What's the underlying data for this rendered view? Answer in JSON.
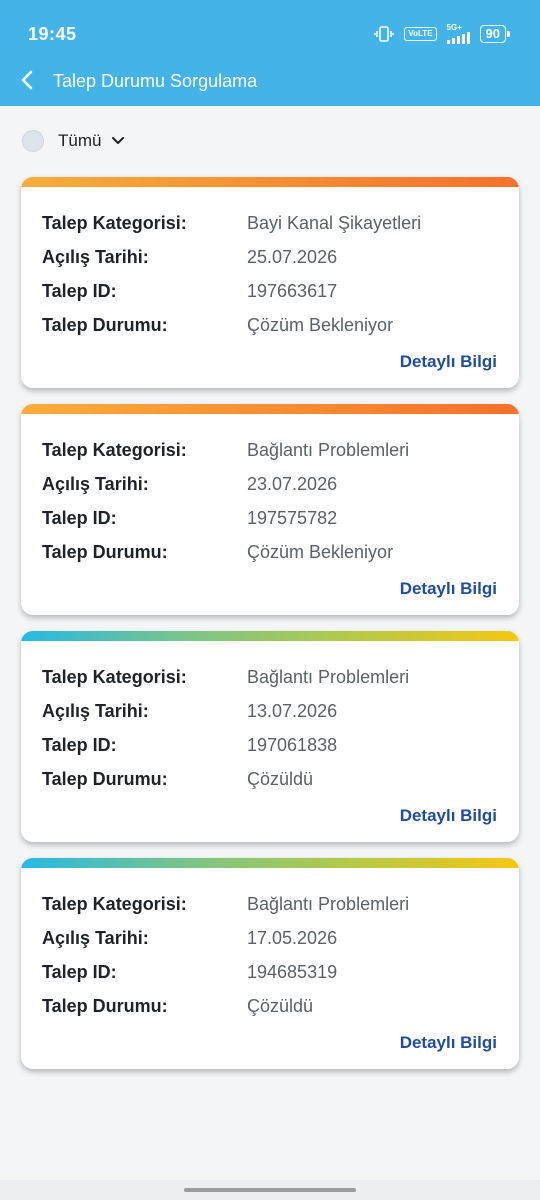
{
  "status_bar": {
    "time": "19:45",
    "volte": "VoLTE",
    "network": "5G+",
    "battery": "90"
  },
  "header": {
    "title": "Talep Durumu Sorgulama"
  },
  "filter": {
    "selected": "Tümü"
  },
  "labels": {
    "category": "Talep Kategorisi:",
    "opened": "Açılış Tarihi:",
    "id": "Talep ID:",
    "status": "Talep Durumu:",
    "detail": "Detaylı Bilgi"
  },
  "requests": [
    {
      "category": "Bayi Kanal Şikayetleri",
      "opened": "25.07.2026",
      "id": "197663617",
      "status": "Çözüm Bekleniyor",
      "accent": "orange"
    },
    {
      "category": "Bağlantı Problemleri",
      "opened": "23.07.2026",
      "id": "197575782",
      "status": "Çözüm Bekleniyor",
      "accent": "orange"
    },
    {
      "category": "Bağlantı Problemleri",
      "opened": "13.07.2026",
      "id": "197061838",
      "status": "Çözüldü",
      "accent": "green"
    },
    {
      "category": "Bağlantı Problemleri",
      "opened": "17.05.2026",
      "id": "194685319",
      "status": "Çözüldü",
      "accent": "green"
    }
  ],
  "colors": {
    "header_bg": "#43b3e8",
    "link": "#1f4e9e",
    "pending_gradient": [
      "#f9ad3c",
      "#f4712b"
    ],
    "resolved_gradient": [
      "#27b9e3",
      "#7cc48a",
      "#b6c949",
      "#f5c712"
    ]
  }
}
